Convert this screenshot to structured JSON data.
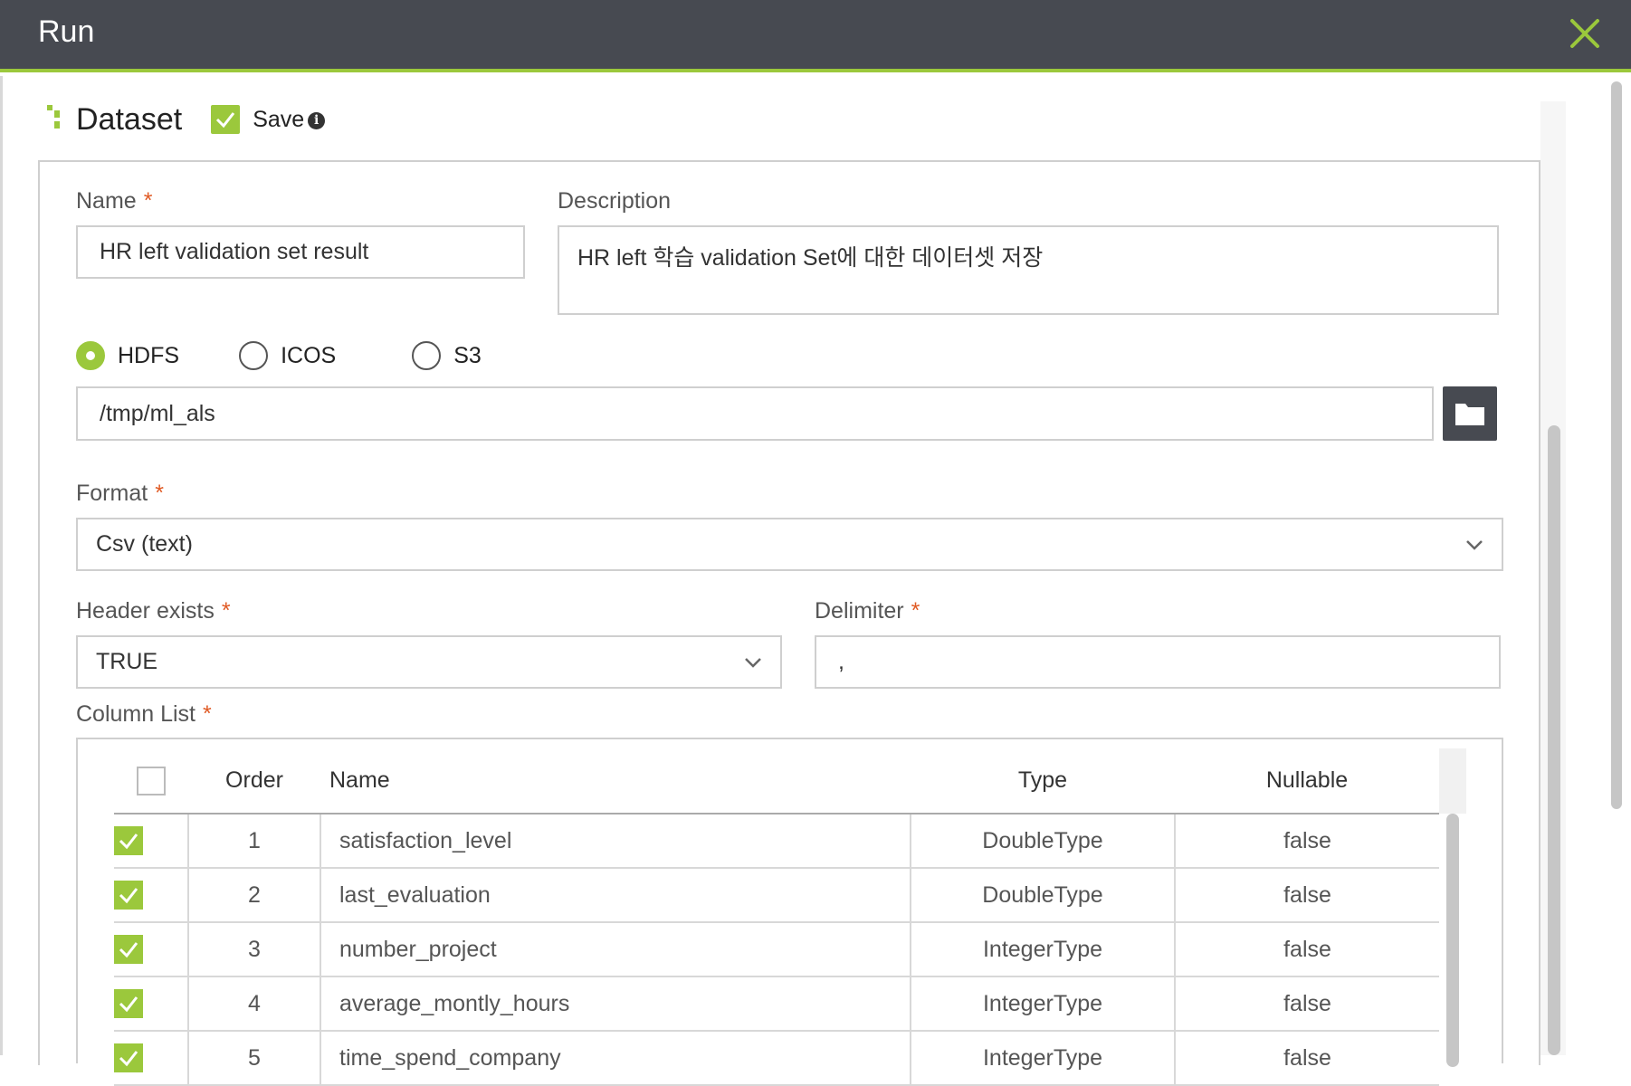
{
  "window": {
    "title": "Run"
  },
  "dataset": {
    "section_title": "Dataset",
    "save_label": "Save",
    "save_checked": true,
    "info_glyph": "i"
  },
  "form": {
    "name_label": "Name",
    "name_value": "HR left validation set result",
    "description_label": "Description",
    "description_value": "HR left 학습 validation Set에 대한 데이터셋 저장",
    "required_mark": "*",
    "storage_options": [
      {
        "label": "HDFS",
        "checked": true
      },
      {
        "label": "ICOS",
        "checked": false
      },
      {
        "label": "S3",
        "checked": false
      }
    ],
    "path_value": "/tmp/ml_als",
    "format_label": "Format",
    "format_value": "Csv (text)",
    "header_label": "Header exists",
    "header_value": "TRUE",
    "delimiter_label": "Delimiter",
    "delimiter_value": ",",
    "column_list_label": "Column List"
  },
  "column_table": {
    "headers": {
      "order": "Order",
      "name": "Name",
      "type": "Type",
      "nullable": "Nullable"
    },
    "rows": [
      {
        "checked": true,
        "order": "1",
        "name": "satisfaction_level",
        "type": "DoubleType",
        "nullable": "false"
      },
      {
        "checked": true,
        "order": "2",
        "name": "last_evaluation",
        "type": "DoubleType",
        "nullable": "false"
      },
      {
        "checked": true,
        "order": "3",
        "name": "number_project",
        "type": "IntegerType",
        "nullable": "false"
      },
      {
        "checked": true,
        "order": "4",
        "name": "average_montly_hours",
        "type": "IntegerType",
        "nullable": "false"
      },
      {
        "checked": true,
        "order": "5",
        "name": "time_spend_company",
        "type": "IntegerType",
        "nullable": "false"
      }
    ]
  },
  "colors": {
    "header_bg": "#474a51",
    "accent_green": "#9bc83c",
    "required_orange": "#e05a24",
    "border": "#cfcfcf"
  },
  "icons": {
    "close": "close-icon",
    "folder": "folder-icon",
    "chevron": "chevron-down-icon",
    "checkbox": "checkmark-icon",
    "info": "info-icon",
    "dataset": "dataset-section-icon"
  }
}
